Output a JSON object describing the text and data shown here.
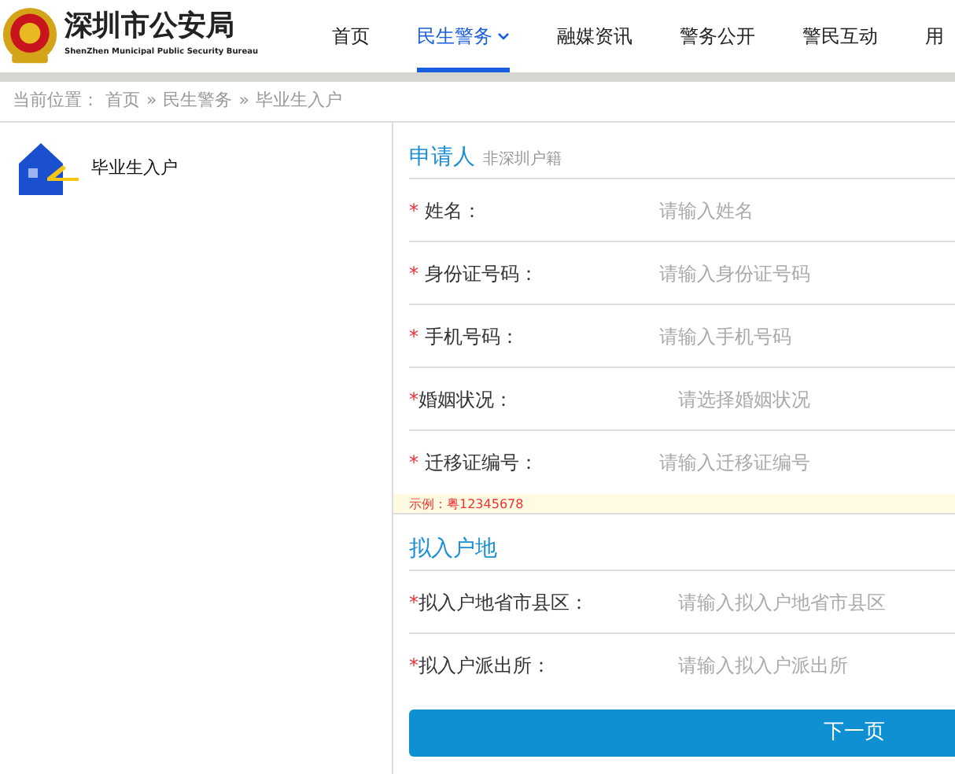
{
  "header": {
    "title": "深圳市公安局",
    "subtitle": "ShenZhen Municipal Public Security Bureau"
  },
  "nav": [
    {
      "label": "首页",
      "selected": false
    },
    {
      "label": "民生警务",
      "selected": true,
      "dropdown": true
    },
    {
      "label": "融媒资讯",
      "selected": false
    },
    {
      "label": "警务公开",
      "selected": false
    },
    {
      "label": "警民互动",
      "selected": false
    },
    {
      "label": "用",
      "selected": false
    }
  ],
  "breadcrumb": {
    "prefix": "当前位置：",
    "items": [
      "首页",
      "民生警务",
      "毕业生入户"
    ],
    "separator": "»"
  },
  "sidebar": {
    "items": [
      {
        "label": "毕业生入户"
      }
    ]
  },
  "sections": [
    {
      "title": "申请人",
      "subtitle": "非深圳户籍",
      "fields": [
        {
          "kind": "spaced",
          "marker": "*",
          "label": "姓名：",
          "placeholder": "请输入姓名"
        },
        {
          "kind": "spaced",
          "marker": "*",
          "label": "身份证号码：",
          "placeholder": "请输入身份证号码"
        },
        {
          "kind": "spaced",
          "marker": "*",
          "label": "手机号码：",
          "placeholder": "请输入手机号码"
        },
        {
          "kind": "tight",
          "marker": "*",
          "label": "婚姻状况：",
          "placeholder": "请选择婚姻状况"
        },
        {
          "kind": "spaced",
          "marker": "*",
          "label": "迁移证编号：",
          "placeholder": "请输入迁移证编号"
        }
      ],
      "hint": "示例：粤12345678"
    },
    {
      "title": "拟入户地",
      "fields": [
        {
          "kind": "tight",
          "marker": "*",
          "label": "拟入户地省市县区：",
          "placeholder": "请输入拟入户地省市县区"
        },
        {
          "kind": "tight",
          "marker": "*",
          "label": "拟入户派出所：",
          "placeholder": "请输入拟入户派出所"
        }
      ]
    }
  ],
  "next_button": "下一页"
}
